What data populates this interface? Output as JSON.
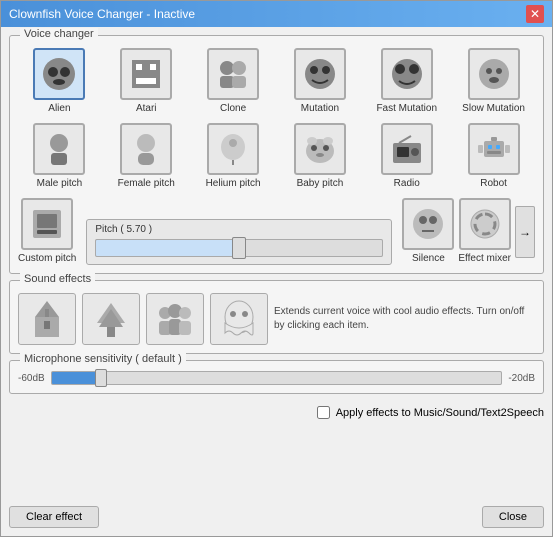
{
  "window": {
    "title": "Clownfish Voice Changer - Inactive",
    "close_label": "✕"
  },
  "voice_changer": {
    "group_label": "Voice changer",
    "voices": [
      {
        "id": "alien",
        "label": "Alien",
        "icon": "👾",
        "active": true
      },
      {
        "id": "atari",
        "label": "Atari",
        "icon": "👾",
        "active": false
      },
      {
        "id": "clone",
        "label": "Clone",
        "icon": "👥",
        "active": false
      },
      {
        "id": "mutation",
        "label": "Mutation",
        "icon": "😵",
        "active": false
      },
      {
        "id": "fast-mutation",
        "label": "Fast\nMutation",
        "icon": "😵",
        "active": false
      },
      {
        "id": "slow-mutation",
        "label": "Slow\nMutation",
        "icon": "😐",
        "active": false
      },
      {
        "id": "male-pitch",
        "label": "Male pitch",
        "icon": "😤",
        "active": false
      },
      {
        "id": "female-pitch",
        "label": "Female pitch",
        "icon": "🧑",
        "active": false
      },
      {
        "id": "helium-pitch",
        "label": "Helium pitch",
        "icon": "🎈",
        "active": false
      },
      {
        "id": "baby-pitch",
        "label": "Baby pitch",
        "icon": "🐄",
        "active": false
      },
      {
        "id": "radio",
        "label": "Radio",
        "icon": "📻",
        "active": false
      },
      {
        "id": "robot",
        "label": "Robot",
        "icon": "🤖",
        "active": false
      }
    ],
    "custom_pitch": {
      "label": "Custom pitch",
      "pitch_display": "Pitch ( 5.70 )",
      "pitch_value": 50,
      "icon": "🖼️"
    },
    "silence": {
      "label": "Silence",
      "icon": "😶"
    },
    "effect_mixer": {
      "label": "Effect mixer",
      "icon": "🌀"
    },
    "arrow_label": "->"
  },
  "sound_effects": {
    "group_label": "Sound effects",
    "items": [
      {
        "id": "church",
        "icon": "⛪"
      },
      {
        "id": "forest",
        "icon": "🌲"
      },
      {
        "id": "crowd",
        "icon": "👥"
      },
      {
        "id": "ghost",
        "icon": "👻"
      }
    ],
    "description": "Extends current voice with cool audio effects. Turn on/off by clicking each item."
  },
  "microphone": {
    "group_label": "Microphone sensitivity ( default )",
    "min_label": "-60dB",
    "max_label": "-20dB",
    "value": 10
  },
  "checkbox": {
    "label": "Apply effects to Music/Sound/Text2Speech"
  },
  "footer": {
    "clear_label": "Clear effect",
    "close_label": "Close"
  }
}
